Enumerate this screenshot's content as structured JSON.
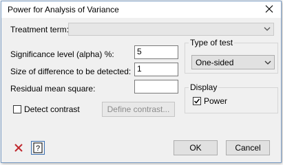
{
  "window": {
    "title": "Power for Analysis of Variance"
  },
  "form": {
    "treatment_term_label": "Treatment term:",
    "treatment_term_value": "",
    "significance_label": "Significance level (alpha) %:",
    "significance_value": "5",
    "difference_label": "Size of difference to be detected:",
    "difference_value": "1",
    "residual_label": "Residual mean square:",
    "residual_value": ""
  },
  "type_of_test": {
    "group_label": "Type of test",
    "selected": "One-sided"
  },
  "display": {
    "group_label": "Display",
    "power_label": "Power",
    "power_checked": true
  },
  "contrast": {
    "detect_label": "Detect contrast",
    "detect_checked": false,
    "define_button": "Define contrast..."
  },
  "footer": {
    "ok_label": "OK",
    "cancel_label": "Cancel"
  },
  "icons": {
    "clear": "red-x-icon",
    "help": "help-icon"
  },
  "colors": {
    "accent_red": "#c0282d",
    "window_bg": "#f0f0f0",
    "border_blue": "#7a9cc4"
  }
}
